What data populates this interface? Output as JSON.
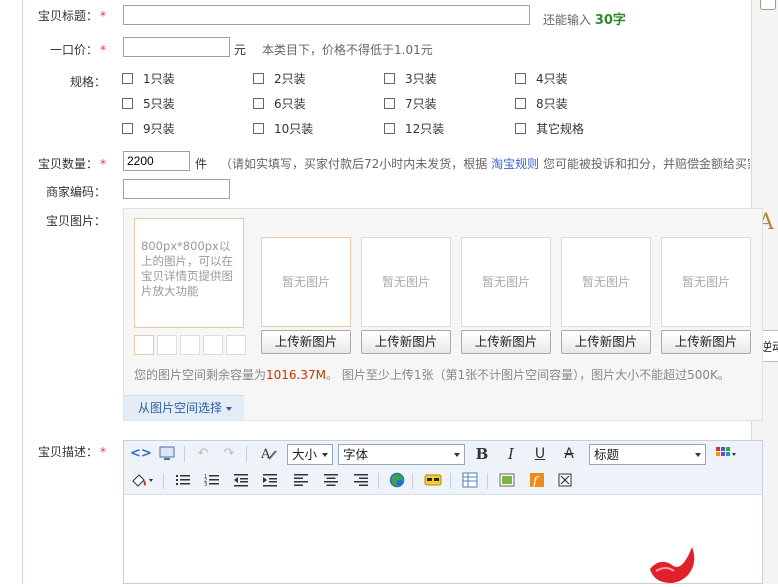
{
  "form": {
    "title": {
      "label": "宝贝标题：",
      "required": "*",
      "value": "",
      "hint_prefix": "还能输入",
      "hint_count": "30字"
    },
    "price": {
      "label": "一口价：",
      "required": "*",
      "value": "",
      "unit": "元",
      "hint": "本类目下，价格不得低于1.01元"
    },
    "spec": {
      "label": "规格：",
      "options": [
        "1只装",
        "2只装",
        "3只装",
        "4只装",
        "5只装",
        "6只装",
        "7只装",
        "8只装",
        "9只装",
        "10只装",
        "12只装",
        "其它规格"
      ]
    },
    "quantity": {
      "label": "宝贝数量：",
      "required": "*",
      "value": "2200",
      "unit": "件",
      "hint_prefix": "（请如实填写，买家付款后72小时内未发货，根据",
      "hint_link": "淘宝规则",
      "hint_suffix": "您可能被投诉和扣分，并赔偿金额给买家"
    },
    "merchant_code": {
      "label": "商家编码：",
      "value": ""
    },
    "images": {
      "label": "宝贝图片：",
      "main_slot_text": "800px*800px以上的图片，可以在宝贝详情页提供图片放大功能",
      "slots": [
        "暂无图片",
        "暂无图片",
        "暂无图片",
        "暂无图片",
        "暂无图片"
      ],
      "upload_label": "上传新图片",
      "space_prefix": "您的图片空间剩余容量为",
      "space_amount": "1016.37M",
      "space_suffix": "。 图片至少上传1张（第1张不计图片空间容量），图片大小不能超过500K。",
      "space_select": "从图片空间选择"
    },
    "description": {
      "label": "宝贝描述：",
      "required": "*",
      "font_size": "大小",
      "font_family": "字体",
      "heading": "标题"
    }
  },
  "side_panel": {
    "text": "逆动"
  }
}
